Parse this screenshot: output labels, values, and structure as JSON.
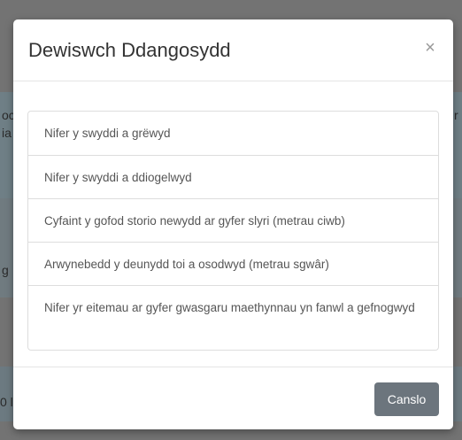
{
  "modal": {
    "title": "Dewiswch Ddangosydd",
    "close_label": "×",
    "indicators": [
      "Nifer y swyddi a grëwyd",
      "Nifer y swyddi a ddiogelwyd",
      "Cyfaint y gofod storio newydd ar gyfer slyri (metrau ciwb)",
      "Arwynebedd y deunydd toi a osodwyd (metrau sgwâr)",
      "Nifer yr eitemau ar gyfer gwasgaru maethynnau yn fanwl a gefnogwyd"
    ],
    "cancel_label": "Canslo"
  },
  "background": {
    "fragments": [
      "oc",
      "ia",
      "r",
      "g",
      "0 l"
    ]
  },
  "colors": {
    "backdrop": "#737373",
    "cancel_button": "#6c757d",
    "list_border": "#dddddd"
  }
}
